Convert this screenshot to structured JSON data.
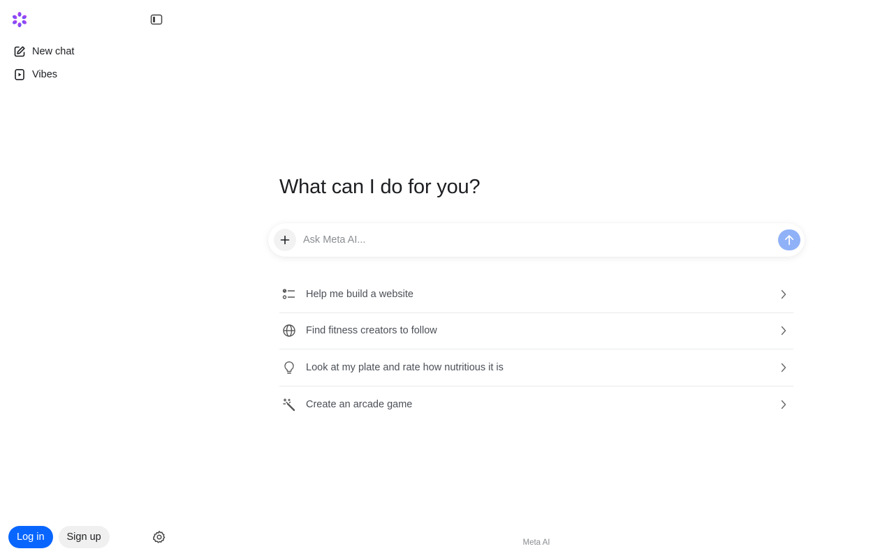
{
  "sidebar": {
    "nav": [
      {
        "label": "New chat",
        "icon": "compose-icon"
      },
      {
        "label": "Vibes",
        "icon": "play-square-icon"
      }
    ],
    "login_label": "Log in",
    "signup_label": "Sign up"
  },
  "main": {
    "headline": "What can I do for you?",
    "composer": {
      "placeholder": "Ask Meta AI..."
    },
    "suggestions": [
      {
        "label": "Help me build a website",
        "icon": "checklist-icon"
      },
      {
        "label": "Find fitness creators to follow",
        "icon": "globe-icon"
      },
      {
        "label": "Look at my plate and rate how nutritious it is",
        "icon": "lightbulb-icon"
      },
      {
        "label": "Create an arcade game",
        "icon": "magic-wand-icon"
      }
    ]
  },
  "footer": {
    "text": "Meta AI"
  },
  "colors": {
    "accent": "#0866ff",
    "send_disabled": "#8fb1f7",
    "logo_gradient": [
      "#c13bf5",
      "#4a5cf7"
    ]
  }
}
